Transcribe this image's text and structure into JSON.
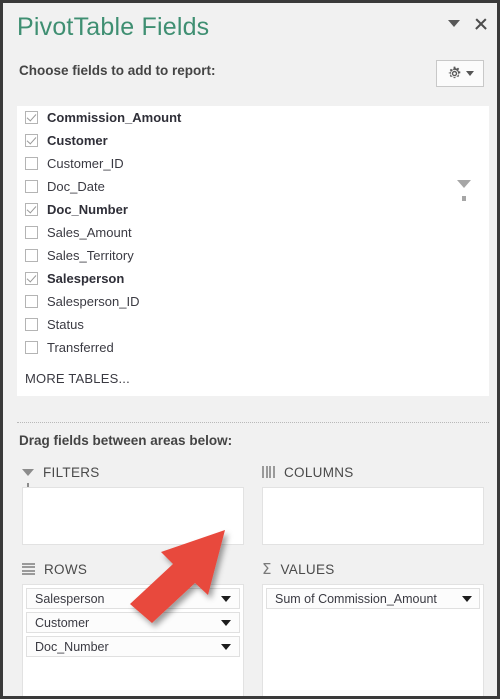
{
  "window": {
    "title": "PivotTable Fields",
    "minimize_icon": "chevron-down-icon",
    "close_icon": "close-icon"
  },
  "fields_section": {
    "heading": "Choose fields to add to report:",
    "settings_button": {
      "icon": "gear-icon",
      "caret_icon": "chevron-down-icon"
    },
    "filter_icon": "funnel-icon",
    "items": [
      {
        "label": "Commission_Amount",
        "checked": true
      },
      {
        "label": "Customer",
        "checked": true
      },
      {
        "label": "Customer_ID",
        "checked": false
      },
      {
        "label": "Doc_Date",
        "checked": false
      },
      {
        "label": "Doc_Number",
        "checked": true
      },
      {
        "label": "Sales_Amount",
        "checked": false
      },
      {
        "label": "Sales_Territory",
        "checked": false
      },
      {
        "label": "Salesperson",
        "checked": true
      },
      {
        "label": "Salesperson_ID",
        "checked": false
      },
      {
        "label": "Status",
        "checked": false
      },
      {
        "label": "Transferred",
        "checked": false
      }
    ],
    "more_tables_label": "MORE TABLES..."
  },
  "areas_section": {
    "heading": "Drag fields between areas below:",
    "filters": {
      "title": "FILTERS",
      "icon": "funnel-icon",
      "items": []
    },
    "columns": {
      "title": "COLUMNS",
      "icon": "columns-icon",
      "items": []
    },
    "rows": {
      "title": "ROWS",
      "icon": "rows-icon",
      "items": [
        {
          "label": "Salesperson"
        },
        {
          "label": "Customer"
        },
        {
          "label": "Doc_Number"
        }
      ]
    },
    "values": {
      "title": "VALUES",
      "icon": "sigma-icon",
      "items": [
        {
          "label": "Sum of Commission_Amount"
        }
      ]
    }
  },
  "annotation": {
    "arrow_icon": "red-arrow-pointing-to-rows-salesperson",
    "color": "#e8483c"
  },
  "colors": {
    "title_green": "#3f8f72",
    "pane_background": "#f1f1f1",
    "panel_white": "#ffffff",
    "arrow_red": "#e8483c"
  }
}
